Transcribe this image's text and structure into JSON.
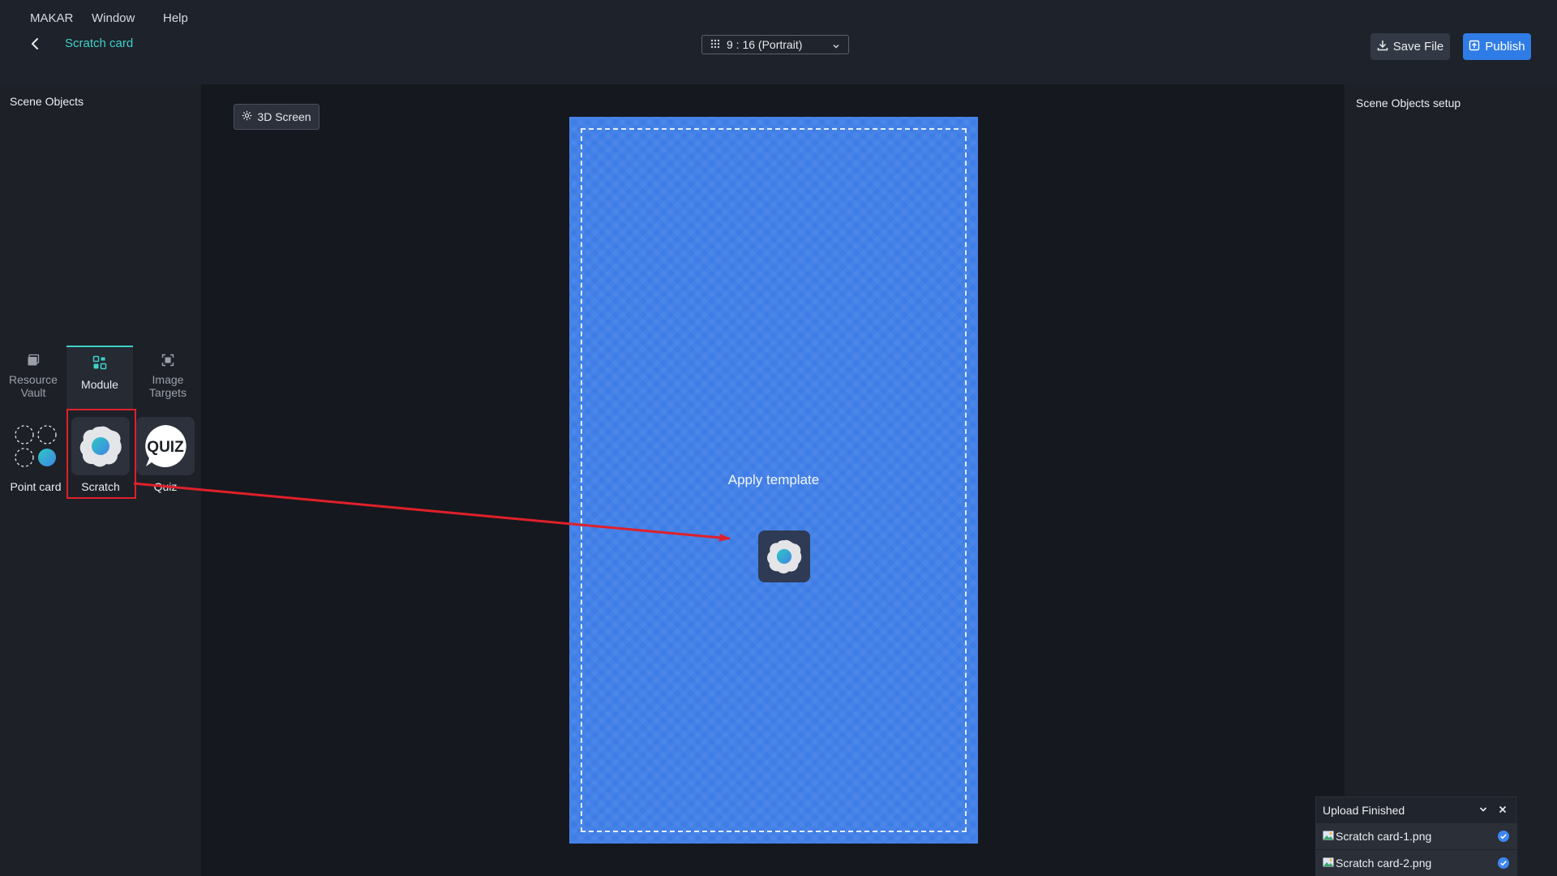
{
  "menu": {
    "items": [
      "MAKAR",
      "Window",
      "Help"
    ]
  },
  "header": {
    "project_name": "Scratch card",
    "aspect_ratio": "9 : 16 (Portrait)",
    "save_label": "Save File",
    "publish_label": "Publish"
  },
  "left_panel": {
    "title": "Scene Objects",
    "tabs": [
      {
        "label": "Resource Vault",
        "active": false,
        "icon": "image-stack-icon"
      },
      {
        "label": "Module",
        "active": true,
        "icon": "module-grid-icon"
      },
      {
        "label": "Image Targets",
        "active": false,
        "icon": "image-target-icon"
      }
    ],
    "modules": [
      {
        "label": "Point card",
        "icon": "point-card-icon"
      },
      {
        "label": "Scratch",
        "icon": "scratch-icon",
        "highlighted": true
      },
      {
        "label": "Quiz",
        "icon": "quiz-icon",
        "icon_text": "QUIZ"
      }
    ]
  },
  "canvas": {
    "screen_toggle": "3D Screen",
    "drop_hint": "Apply template"
  },
  "right_panel": {
    "title": "Scene Objects setup"
  },
  "upload": {
    "title": "Upload Finished",
    "files": [
      {
        "name": "Scratch card-1.png",
        "status": "done"
      },
      {
        "name": "Scratch card-2.png",
        "status": "done"
      }
    ]
  },
  "colors": {
    "accent_teal": "#3fd0c9",
    "publish_blue": "#2f7ce6",
    "canvas_blue": "#3e7de6",
    "annotation_red": "#e0202a"
  }
}
